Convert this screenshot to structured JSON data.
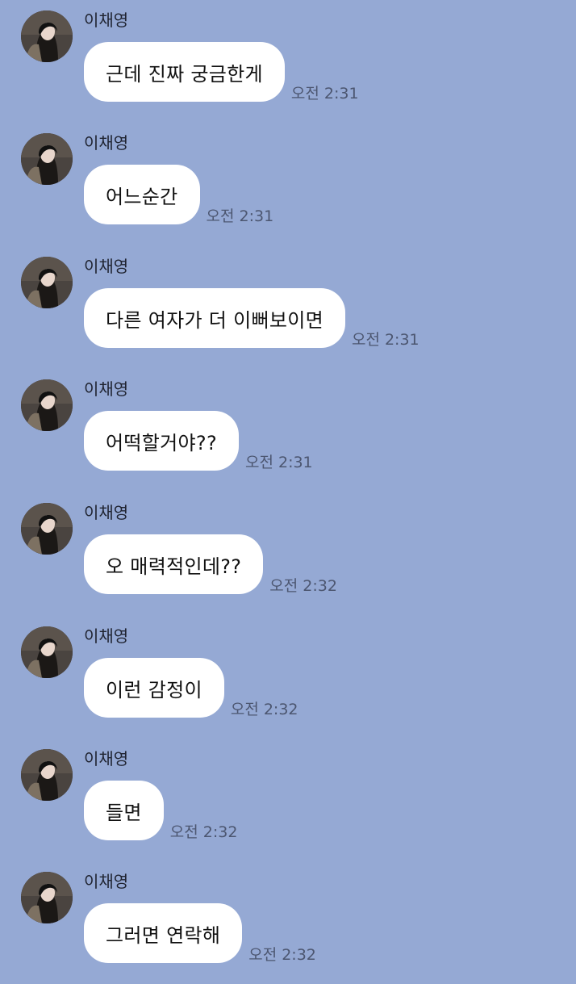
{
  "chat": {
    "messages": [
      {
        "sender": "이채영",
        "text": "근데 진짜 궁금한게",
        "time": "오전 2:31"
      },
      {
        "sender": "이채영",
        "text": "어느순간",
        "time": "오전 2:31"
      },
      {
        "sender": "이채영",
        "text": "다른 여자가 더 이뻐보이면",
        "time": "오전 2:31"
      },
      {
        "sender": "이채영",
        "text": "어떡할거야??",
        "time": "오전 2:31"
      },
      {
        "sender": "이채영",
        "text": "오 매력적인데??",
        "time": "오전 2:32"
      },
      {
        "sender": "이채영",
        "text": "이런 감정이",
        "time": "오전 2:32"
      },
      {
        "sender": "이채영",
        "text": "들면",
        "time": "오전 2:32"
      },
      {
        "sender": "이채영",
        "text": "그러면 연락해",
        "time": "오전 2:32"
      }
    ]
  },
  "theme": {
    "background": "#95a9d4",
    "bubble": "#ffffff",
    "time_color": "#4c5670"
  },
  "icons": {
    "avatar": "profile-photo-icon"
  }
}
